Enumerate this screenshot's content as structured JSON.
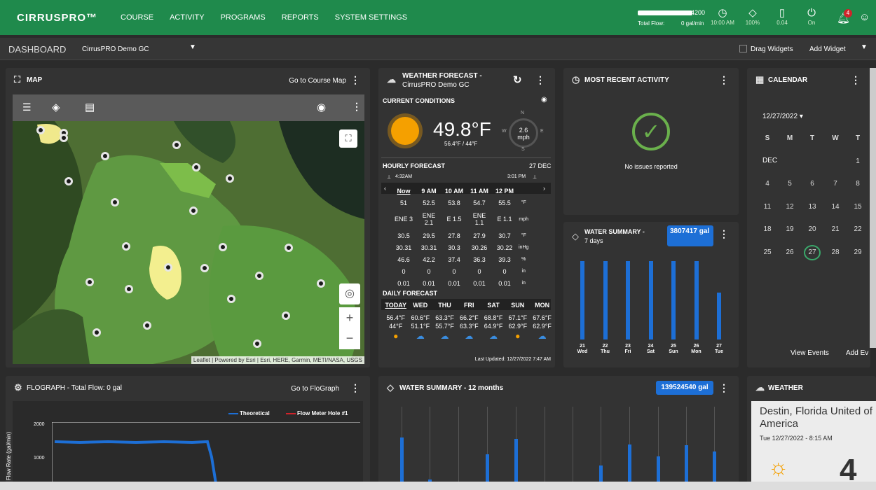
{
  "topbar": {
    "logo": "CIRRUSPRO™",
    "nav": [
      "COURSE",
      "ACTIVITY",
      "PROGRAMS",
      "REPORTS",
      "SYSTEM SETTINGS"
    ],
    "total_flow": {
      "label": "Total Flow:",
      "value": "0 gal/min",
      "max": "4200"
    },
    "stats": [
      {
        "icon": "clock",
        "text": "10:00 AM"
      },
      {
        "icon": "drop",
        "text": "100%"
      },
      {
        "icon": "gauge",
        "text": "0.04"
      },
      {
        "icon": "power",
        "text": "On"
      }
    ],
    "alerts_count": "4"
  },
  "subbar": {
    "dashboard": "DASHBOARD",
    "course": "CirrusPRO Demo GC",
    "drag": "Drag Widgets",
    "add": "Add Widget"
  },
  "map": {
    "title": "MAP",
    "go": "Go to Course Map",
    "attribution": "Leaflet | Powered by Esri | Esri, HERE, Garmin, METI/NASA, USGS"
  },
  "weather_fc": {
    "title": "WEATHER FORECAST -",
    "subtitle": "CirrusPRO Demo GC",
    "current": "CURRENT CONDITIONS",
    "temp": "49.8°F",
    "hilo": "56.4°F / 44°F",
    "wind": "2.6",
    "wind_unit": "mph",
    "n": "N",
    "e": "E",
    "s": "S",
    "w": "W",
    "hourly": "HOURLY FORECAST",
    "date": "27 DEC",
    "sunrise": "4:32AM",
    "sunset": "3:01 PM",
    "hours": [
      "Now",
      "9 AM",
      "10 AM",
      "11 AM",
      "12 PM"
    ],
    "rows": [
      [
        "51",
        "52.5",
        "53.8",
        "54.7",
        "55.5",
        "°F"
      ],
      [
        "ENE 3",
        "ENE 2.1",
        "E 1.5",
        "ENE 1.1",
        "E 1.1",
        "mph"
      ],
      [
        "30.5",
        "29.5",
        "27.8",
        "27.9",
        "30.7",
        "°F"
      ],
      [
        "30.31",
        "30.31",
        "30.3",
        "30.26",
        "30.22",
        "inHg"
      ],
      [
        "46.6",
        "42.2",
        "37.4",
        "36.3",
        "39.3",
        "%"
      ],
      [
        "0",
        "0",
        "0",
        "0",
        "0",
        "in"
      ],
      [
        "0.01",
        "0.01",
        "0.01",
        "0.01",
        "0.01",
        "in"
      ]
    ],
    "daily": "DAILY FORECAST",
    "days": [
      "TODAY",
      "WED",
      "THU",
      "FRI",
      "SAT",
      "SUN",
      "MON"
    ],
    "hi": [
      "56.4°F",
      "60.6°F",
      "63.3°F",
      "66.2°F",
      "68.8°F",
      "67.1°F",
      "67.6°F"
    ],
    "lo": [
      "44°F",
      "51.1°F",
      "55.7°F",
      "63.3°F",
      "64.9°F",
      "62.9°F",
      "62.9°F"
    ],
    "updated": "Last Updated: 12/27/2022 7:47 AM"
  },
  "activity": {
    "title": "MOST RECENT ACTIVITY",
    "msg": "No issues reported"
  },
  "water7": {
    "title": "WATER SUMMARY -",
    "subtitle": "7 days",
    "badge": "3807417 gal",
    "days": [
      [
        "21",
        "Wed"
      ],
      [
        "22",
        "Thu"
      ],
      [
        "23",
        "Fri"
      ],
      [
        "24",
        "Sat"
      ],
      [
        "25",
        "Sun"
      ],
      [
        "26",
        "Mon"
      ],
      [
        "27",
        "Tue"
      ]
    ],
    "values": [
      1.0,
      1.0,
      1.0,
      1.0,
      1.0,
      1.0,
      0.6
    ]
  },
  "calendar": {
    "title": "CALENDAR",
    "date": "12/27/2022 ▾",
    "dow": [
      "S",
      "M",
      "T",
      "W",
      "T"
    ],
    "month": "DEC",
    "weeks": [
      [
        "",
        "",
        "",
        "",
        "1"
      ],
      [
        "4",
        "5",
        "6",
        "7",
        "8"
      ],
      [
        "11",
        "12",
        "13",
        "14",
        "15"
      ],
      [
        "18",
        "19",
        "20",
        "21",
        "22"
      ],
      [
        "25",
        "26",
        "27",
        "28",
        "29"
      ]
    ],
    "view": "View Events",
    "add": "Add Ev"
  },
  "flograph": {
    "title": "FLOGRAPH - Total Flow: 0 gal",
    "go": "Go to FloGraph",
    "legend": [
      "Theoretical",
      "Flow Meter Hole #1"
    ],
    "ylabel": "Flow Rate (gal/min)",
    "yticks": [
      "2000",
      "1000"
    ]
  },
  "water12": {
    "title": "WATER SUMMARY - 12 months",
    "badge": "139524540 gal"
  },
  "weather": {
    "title": "WEATHER",
    "location": "Destin, Florida United of America",
    "time": "Tue 12/27/2022 - 8:15 AM"
  },
  "colors": {
    "green": "#1f8a4c",
    "blue": "#1d6fd6",
    "panel": "#333333"
  }
}
